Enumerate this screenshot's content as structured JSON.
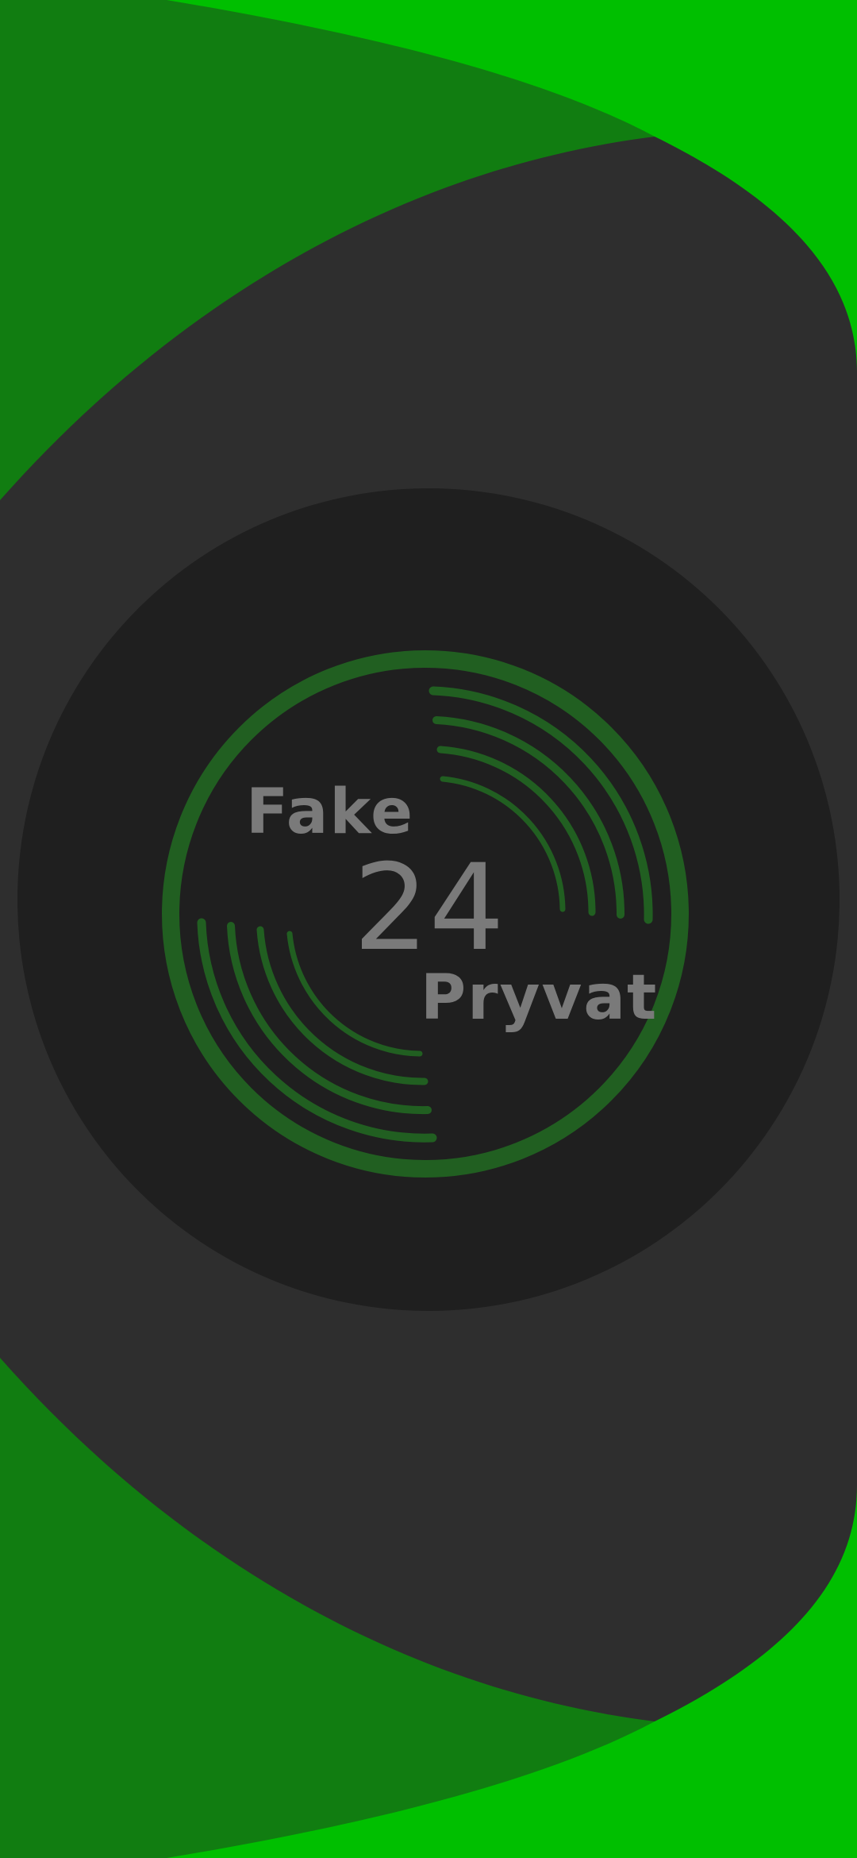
{
  "splash": {
    "logo": {
      "word_top": "Fake",
      "number": "24",
      "word_bottom": "Pryvat"
    }
  },
  "colors": {
    "bright_green": "#00bf00",
    "dark_green": "#117d11",
    "outer_panel": "#2e2e2e",
    "inner_disc": "#1f1f1f",
    "ring_green": "#215f21",
    "logo_text": "#7a7a7a"
  }
}
